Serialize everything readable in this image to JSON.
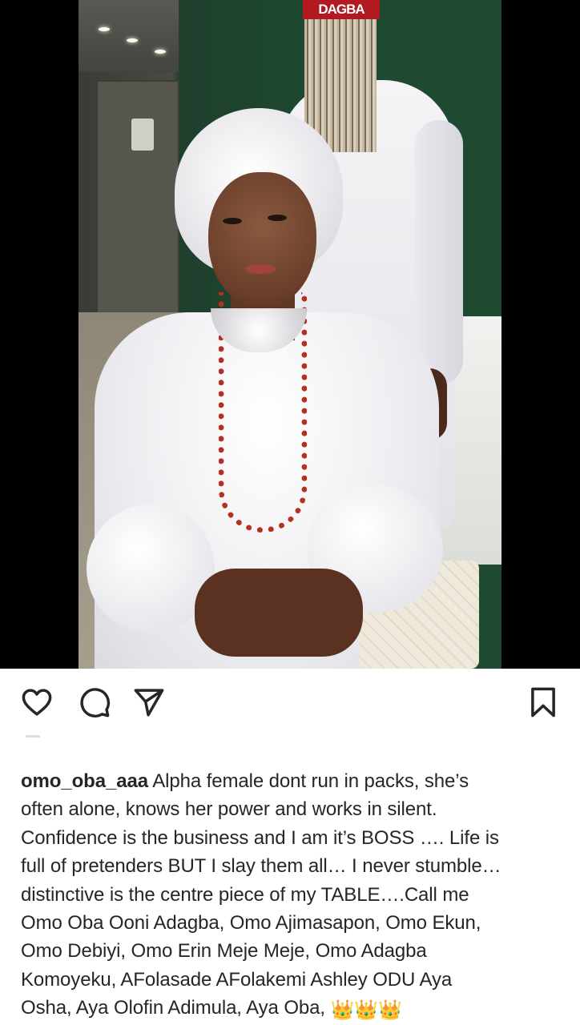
{
  "post": {
    "image_overlay_text": "DAGBA",
    "username": "omo_oba_aaa",
    "caption_lines": [
      "Alpha female dont run in packs, she’s",
      "often alone, knows her power and works in silent.",
      "Confidence is the business and I am it’s BOSS …. Life is",
      "full of pretenders BUT I slay them all… I never stumble…",
      "distinctive is the centre piece of my TABLE….Call me",
      "Omo Oba Ooni Adagba, Omo Ajimasapon, Omo Ekun,",
      "Omo Debiyi, Omo Erin Meje Meje, Omo Adagba",
      "Komoyeku,  AFolasade AFolakemi Ashley ODU Aya",
      "Osha, Aya Olofin Adimula, Aya Oba,"
    ],
    "caption_emoji": "👑👑👑"
  },
  "actions": {
    "like_icon": "heart-icon",
    "comment_icon": "comment-bubble-icon",
    "share_icon": "paper-plane-icon",
    "save_icon": "bookmark-icon"
  },
  "colors": {
    "text": "#262626",
    "background": "#ffffff",
    "photo_letterbox": "#000000"
  }
}
